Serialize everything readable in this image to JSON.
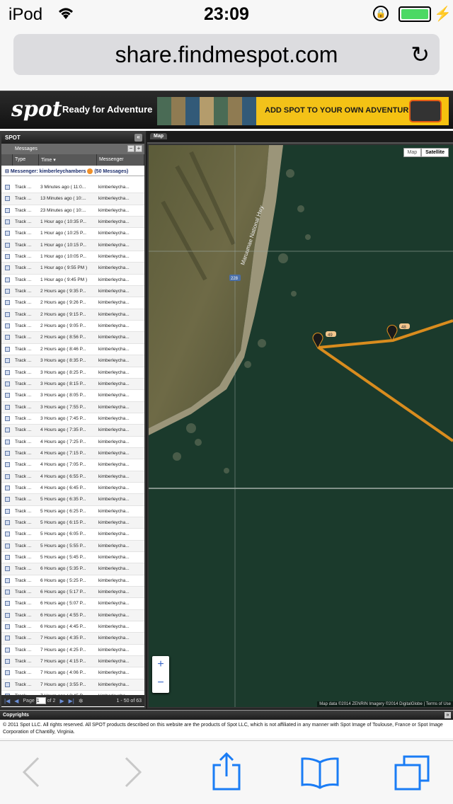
{
  "status_bar": {
    "carrier": "iPod",
    "time": "23:09",
    "wifi_icon": "wifi-icon",
    "lock_icon": "rotation-lock-icon",
    "battery_icon": "battery-icon"
  },
  "url_bar": {
    "url": "share.findmespot.com",
    "reload_icon": "reload-icon"
  },
  "banner": {
    "logo": "spot",
    "tagline": "Ready for Adventure",
    "cta": "ADD SPOT TO YOUR OWN ADVENTURES >>"
  },
  "left_panel": {
    "title": "SPOT",
    "subtitle": "Messages",
    "columns": [
      "Type",
      "Time",
      "Messenger"
    ],
    "group": {
      "label": "Messenger: kimberleychambers",
      "count": "(50 Messages)"
    },
    "rows": [
      {
        "type": "Track ...",
        "time": "3 Minutes ago ( 11:0...",
        "messenger": "kimberleycha..."
      },
      {
        "type": "Track ...",
        "time": "13 Minutes ago ( 10:...",
        "messenger": "kimberleycha..."
      },
      {
        "type": "Track ...",
        "time": "23 Minutes ago ( 10:...",
        "messenger": "kimberleycha..."
      },
      {
        "type": "Track ...",
        "time": "1 Hour ago ( 10:35 P...",
        "messenger": "kimberleycha..."
      },
      {
        "type": "Track ...",
        "time": "1 Hour ago ( 10:25 P...",
        "messenger": "kimberleycha..."
      },
      {
        "type": "Track ...",
        "time": "1 Hour ago ( 10:15 P...",
        "messenger": "kimberleycha..."
      },
      {
        "type": "Track ...",
        "time": "1 Hour ago ( 10:05 P...",
        "messenger": "kimberleycha..."
      },
      {
        "type": "Track ...",
        "time": "1 Hour ago ( 9:55 PM )",
        "messenger": "kimberleycha..."
      },
      {
        "type": "Track ...",
        "time": "1 Hour ago ( 9:45 PM )",
        "messenger": "kimberleycha..."
      },
      {
        "type": "Track ...",
        "time": "2 Hours ago ( 9:35 P...",
        "messenger": "kimberleycha..."
      },
      {
        "type": "Track ...",
        "time": "2 Hours ago ( 9:26 P...",
        "messenger": "kimberleycha..."
      },
      {
        "type": "Track ...",
        "time": "2 Hours ago ( 9:15 P...",
        "messenger": "kimberleycha..."
      },
      {
        "type": "Track ...",
        "time": "2 Hours ago ( 9:05 P...",
        "messenger": "kimberleycha..."
      },
      {
        "type": "Track ...",
        "time": "2 Hours ago ( 8:56 P...",
        "messenger": "kimberleycha..."
      },
      {
        "type": "Track ...",
        "time": "2 Hours ago ( 8:46 P...",
        "messenger": "kimberleycha..."
      },
      {
        "type": "Track ...",
        "time": "3 Hours ago ( 8:35 P...",
        "messenger": "kimberleycha..."
      },
      {
        "type": "Track ...",
        "time": "3 Hours ago ( 8:25 P...",
        "messenger": "kimberleycha..."
      },
      {
        "type": "Track ...",
        "time": "3 Hours ago ( 8:15 P...",
        "messenger": "kimberleycha..."
      },
      {
        "type": "Track ...",
        "time": "3 Hours ago ( 8:05 P...",
        "messenger": "kimberleycha..."
      },
      {
        "type": "Track ...",
        "time": "3 Hours ago ( 7:55 P...",
        "messenger": "kimberleycha..."
      },
      {
        "type": "Track ...",
        "time": "3 Hours ago ( 7:45 P...",
        "messenger": "kimberleycha..."
      },
      {
        "type": "Track ...",
        "time": "4 Hours ago ( 7:35 P...",
        "messenger": "kimberleycha..."
      },
      {
        "type": "Track ...",
        "time": "4 Hours ago ( 7:25 P...",
        "messenger": "kimberleycha..."
      },
      {
        "type": "Track ...",
        "time": "4 Hours ago ( 7:15 P...",
        "messenger": "kimberleycha..."
      },
      {
        "type": "Track ...",
        "time": "4 Hours ago ( 7:05 P...",
        "messenger": "kimberleycha..."
      },
      {
        "type": "Track ...",
        "time": "4 Hours ago ( 6:55 P...",
        "messenger": "kimberleycha..."
      },
      {
        "type": "Track ...",
        "time": "4 Hours ago ( 6:45 P...",
        "messenger": "kimberleycha..."
      },
      {
        "type": "Track ...",
        "time": "5 Hours ago ( 6:35 P...",
        "messenger": "kimberleycha..."
      },
      {
        "type": "Track ...",
        "time": "5 Hours ago ( 6:25 P...",
        "messenger": "kimberleycha..."
      },
      {
        "type": "Track ...",
        "time": "5 Hours ago ( 6:15 P...",
        "messenger": "kimberleycha..."
      },
      {
        "type": "Track ...",
        "time": "5 Hours ago ( 6:05 P...",
        "messenger": "kimberleycha..."
      },
      {
        "type": "Track ...",
        "time": "5 Hours ago ( 5:55 P...",
        "messenger": "kimberleycha..."
      },
      {
        "type": "Track ...",
        "time": "5 Hours ago ( 5:45 P...",
        "messenger": "kimberleycha..."
      },
      {
        "type": "Track ...",
        "time": "6 Hours ago ( 5:35 P...",
        "messenger": "kimberleycha..."
      },
      {
        "type": "Track ...",
        "time": "6 Hours ago ( 5:25 P...",
        "messenger": "kimberleycha..."
      },
      {
        "type": "Track ...",
        "time": "6 Hours ago ( 5:17 P...",
        "messenger": "kimberleycha..."
      },
      {
        "type": "Track ...",
        "time": "6 Hours ago ( 5:07 P...",
        "messenger": "kimberleycha..."
      },
      {
        "type": "Track ...",
        "time": "6 Hours ago ( 4:55 P...",
        "messenger": "kimberleycha..."
      },
      {
        "type": "Track ...",
        "time": "6 Hours ago ( 4:45 P...",
        "messenger": "kimberleycha..."
      },
      {
        "type": "Track ...",
        "time": "7 Hours ago ( 4:35 P...",
        "messenger": "kimberleycha..."
      },
      {
        "type": "Track ...",
        "time": "7 Hours ago ( 4:25 P...",
        "messenger": "kimberleycha..."
      },
      {
        "type": "Track ...",
        "time": "7 Hours ago ( 4:15 P...",
        "messenger": "kimberleycha..."
      },
      {
        "type": "Track ...",
        "time": "7 Hours ago ( 4:06 P...",
        "messenger": "kimberleycha..."
      },
      {
        "type": "Track ...",
        "time": "7 Hours ago ( 3:55 P...",
        "messenger": "kimberleycha..."
      },
      {
        "type": "Track ...",
        "time": "7 Hours ago ( 3:45 P...",
        "messenger": "kimberleycha..."
      }
    ],
    "pager": {
      "page_label": "Page",
      "page_value": "1",
      "of_label": "of 2",
      "info": "1 - 50 of 63"
    }
  },
  "map_panel": {
    "tab": "Map",
    "map_type": [
      "Map",
      "Satellite"
    ],
    "selected_type": "Satellite",
    "road_label": "Maruumae National Hwy",
    "road_shield": "228",
    "markers": [
      "49",
      "48"
    ],
    "zoom_in": "+",
    "zoom_out": "−",
    "attribution": "Map data ©2014 ZENRIN Imagery ©2014 DigitalGlobe",
    "terms": "Terms of Use"
  },
  "copyrights": {
    "title": "Copyrights",
    "text": "© 2011 Spot LLC. All rights reserved. All SPOT products described on this website are the products of Spot LLC, which is not affiliated in any manner with Spot Image of Toulouse, France or Spot Image Corporation of Chantilly, Virginia."
  },
  "toolbar": {
    "icons": [
      "back-icon",
      "forward-icon",
      "share-icon",
      "bookmarks-icon",
      "tabs-icon"
    ]
  },
  "colors": {
    "track_line": "#d98c1e",
    "accent": "#1a7cf5",
    "battery": "#4cd964"
  }
}
